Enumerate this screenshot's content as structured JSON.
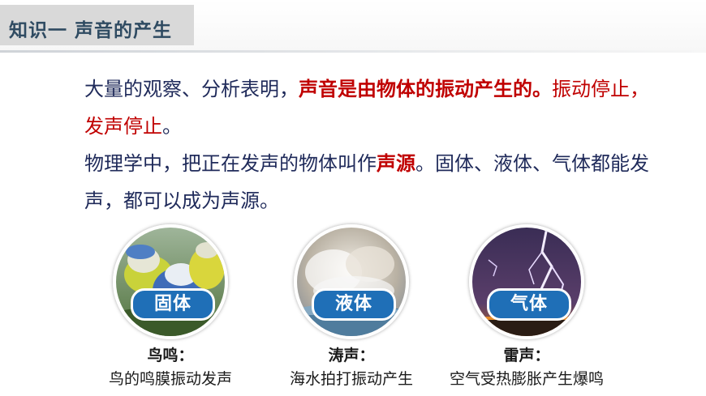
{
  "header": {
    "title": "知识一  声音的产生"
  },
  "paragraph1": {
    "part1": "大量的观察、分析表明，",
    "emphasis": "声音是由物体的振动产生的",
    "part2": "。",
    "part3": "振动停止，发声停止",
    "part4": "。"
  },
  "paragraph2": {
    "part1": "物理学中，把正在发声的物体叫作",
    "emphasis": "声源",
    "part2": "。固体、液体、气体都能发声，都可以成为声源。"
  },
  "examples": [
    {
      "badge": "固体",
      "title": "鸟鸣：",
      "desc": "鸟的鸣膜振动发声"
    },
    {
      "badge": "液体",
      "title": "涛声：",
      "desc": "海水拍打振动产生"
    },
    {
      "badge": "气体",
      "title": "雷声：",
      "desc": "空气受热膨胀产生爆鸣"
    }
  ],
  "colors": {
    "accent_red": "#c00000",
    "text_blue": "#1f2a5a",
    "badge_blue": "#1f6fb7",
    "title_box": "#d9d9d9"
  }
}
